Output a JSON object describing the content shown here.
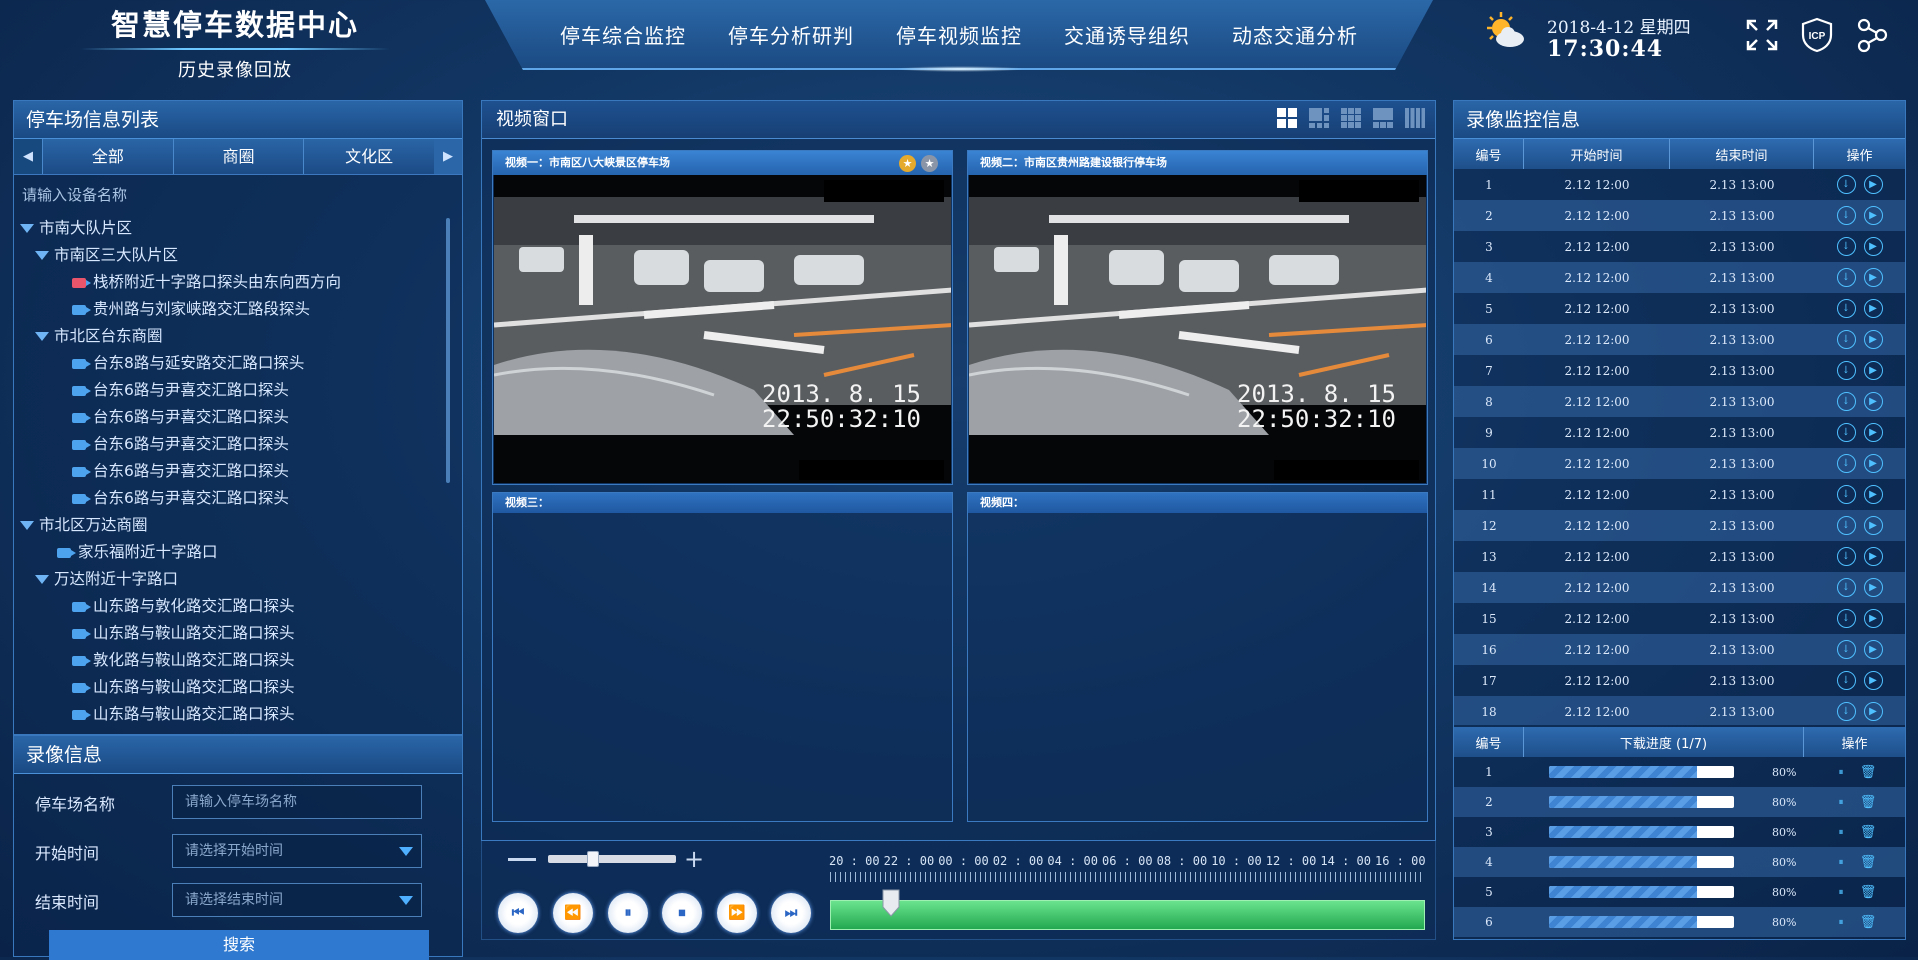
{
  "header": {
    "title": "智慧停车数据中心",
    "subtitle": "历史录像回放",
    "nav": [
      "停车综合监控",
      "停车分析研判",
      "停车视频监控",
      "交通诱导组织",
      "动态交通分析"
    ],
    "date": "2018-4-12  星期四",
    "time": "17:30:44",
    "icp_label": "ICP",
    "icons": [
      "weather-sunny-cloud-icon",
      "fullscreen-icon",
      "icp-badge-icon",
      "share-network-icon"
    ]
  },
  "left": {
    "title": "停车场信息列表",
    "tabs": [
      "全部",
      "商圈",
      "文化区"
    ],
    "search_placeholder": "请输入设备名称",
    "tree": [
      {
        "label": "市南大队片区",
        "level": 0,
        "type": "group"
      },
      {
        "label": "市南区三大队片区",
        "level": 1,
        "type": "group"
      },
      {
        "label": "栈桥附近十字路口探头由东向西方向",
        "level": 2,
        "type": "cam-warn"
      },
      {
        "label": "贵州路与刘家峡路交汇路段探头",
        "level": 2,
        "type": "cam"
      },
      {
        "label": "市北区台东商圈",
        "level": 1,
        "type": "group"
      },
      {
        "label": "台东8路与延安路交汇路口探头",
        "level": 2,
        "type": "cam"
      },
      {
        "label": "台东6路与尹喜交汇路口探头",
        "level": 2,
        "type": "cam"
      },
      {
        "label": "台东6路与尹喜交汇路口探头",
        "level": 2,
        "type": "cam"
      },
      {
        "label": "台东6路与尹喜交汇路口探头",
        "level": 2,
        "type": "cam"
      },
      {
        "label": "台东6路与尹喜交汇路口探头",
        "level": 2,
        "type": "cam"
      },
      {
        "label": "台东6路与尹喜交汇路口探头",
        "level": 2,
        "type": "cam"
      },
      {
        "label": "市北区万达商圈",
        "level": 0,
        "type": "group"
      },
      {
        "label": "家乐福附近十字路口",
        "level": 1,
        "type": "cam"
      },
      {
        "label": "万达附近十字路口",
        "level": 1,
        "type": "group"
      },
      {
        "label": "山东路与敦化路交汇路口探头",
        "level": 2,
        "type": "cam"
      },
      {
        "label": "山东路与鞍山路交汇路口探头",
        "level": 2,
        "type": "cam"
      },
      {
        "label": "敦化路与鞍山路交汇路口探头",
        "level": 2,
        "type": "cam"
      },
      {
        "label": "山东路与鞍山路交汇路口探头",
        "level": 2,
        "type": "cam"
      },
      {
        "label": "山东路与鞍山路交汇路口探头",
        "level": 2,
        "type": "cam"
      }
    ]
  },
  "record": {
    "title": "录像信息",
    "fields": [
      {
        "label": "停车场名称",
        "placeholder": "请输入停车场名称",
        "dropdown": false
      },
      {
        "label": "开始时间",
        "placeholder": "请选择开始时间",
        "dropdown": true
      },
      {
        "label": "结束时间",
        "placeholder": "请选择结束时间",
        "dropdown": true
      }
    ],
    "search": "搜索"
  },
  "video": {
    "title": "视频窗口",
    "windows": [
      {
        "title": "视频一：市南区八大峡景区停车场",
        "stamp_date": "2013. 8. 15",
        "stamp_time": "22:50:32:10"
      },
      {
        "title": "视频二：市南区贵州路建设银行停车场",
        "stamp_date": "2013. 8. 15",
        "stamp_time": "22:50:32:10"
      },
      {
        "title": "视频三：",
        "stamp_date": "",
        "stamp_time": ""
      },
      {
        "title": "视频四：",
        "stamp_date": "",
        "stamp_time": ""
      }
    ],
    "zoom_level": 0.35,
    "ticks": [
      "20 : 00",
      "22 : 00",
      "00 : 00",
      "02 : 00",
      "04 : 00",
      "06 : 00",
      "08 : 00",
      "10 : 00",
      "12 : 00",
      "14 : 00",
      "16 : 00"
    ],
    "timeline_position": 0.1,
    "controls": [
      "⏮",
      "⏪",
      "⏸",
      "⏹",
      "⏩",
      "⏭"
    ]
  },
  "right": {
    "title": "录像监控信息",
    "headers": [
      "编号",
      "开始时间",
      "结束时间",
      "操作"
    ],
    "rows": [
      [
        "1",
        "2.12 12:00",
        "2.13 13:00"
      ],
      [
        "2",
        "2.12 12:00",
        "2.13 13:00"
      ],
      [
        "3",
        "2.12 12:00",
        "2.13 13:00"
      ],
      [
        "4",
        "2.12 12:00",
        "2.13 13:00"
      ],
      [
        "5",
        "2.12 12:00",
        "2.13 13:00"
      ],
      [
        "6",
        "2.12 12:00",
        "2.13 13:00"
      ],
      [
        "7",
        "2.12 12:00",
        "2.13 13:00"
      ],
      [
        "8",
        "2.12 12:00",
        "2.13 13:00"
      ],
      [
        "9",
        "2.12 12:00",
        "2.13 13:00"
      ],
      [
        "10",
        "2.12 12:00",
        "2.13 13:00"
      ],
      [
        "11",
        "2.12 12:00",
        "2.13 13:00"
      ],
      [
        "12",
        "2.12 12:00",
        "2.13 13:00"
      ],
      [
        "13",
        "2.12 12:00",
        "2.13 13:00"
      ],
      [
        "14",
        "2.12 12:00",
        "2.13 13:00"
      ],
      [
        "15",
        "2.12 12:00",
        "2.13 13:00"
      ],
      [
        "16",
        "2.12 12:00",
        "2.13 13:00"
      ],
      [
        "17",
        "2.12 12:00",
        "2.13 13:00"
      ],
      [
        "18",
        "2.12 12:00",
        "2.13 13:00"
      ]
    ],
    "dl_headers": [
      "编号",
      "下载进度 (1/7)",
      "操作"
    ],
    "downloads": [
      {
        "id": "1",
        "progress": 0.8,
        "label": "80%"
      },
      {
        "id": "2",
        "progress": 0.8,
        "label": "80%"
      },
      {
        "id": "3",
        "progress": 0.8,
        "label": "80%"
      },
      {
        "id": "4",
        "progress": 0.8,
        "label": "80%"
      },
      {
        "id": "5",
        "progress": 0.8,
        "label": "80%"
      },
      {
        "id": "6",
        "progress": 0.8,
        "label": "80%"
      }
    ]
  }
}
